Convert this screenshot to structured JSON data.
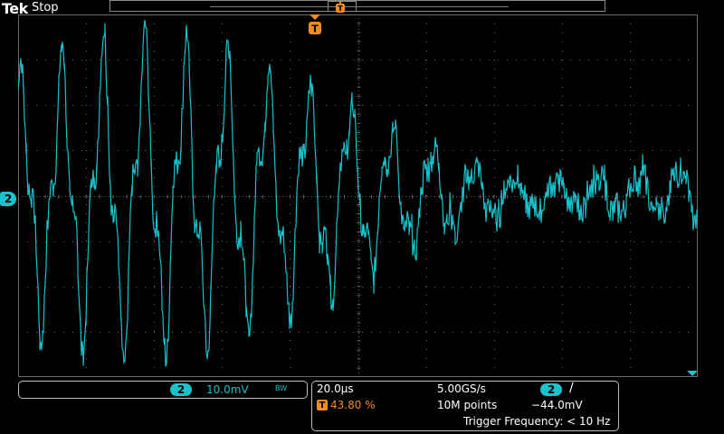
{
  "header": {
    "logo": "Tek",
    "state": "Stop"
  },
  "colors": {
    "trace": "#19c2cc",
    "trigger": "#f28c1c",
    "grid": "#6a6a6a"
  },
  "channel": {
    "id": "2",
    "scale": "10.0mV",
    "bandwidth_limit": "BW"
  },
  "acquisition": {
    "timebase": "20.0µs",
    "sample_rate": "5.00GS/s",
    "record_length": "10M points"
  },
  "trigger": {
    "marker": "T",
    "position": "43.80 %",
    "source": "2",
    "slope_icon": "rising-edge-icon",
    "slope_glyph": "∕",
    "level": "−44.0mV",
    "frequency": "Trigger Frequency: < 10 Hz"
  }
}
